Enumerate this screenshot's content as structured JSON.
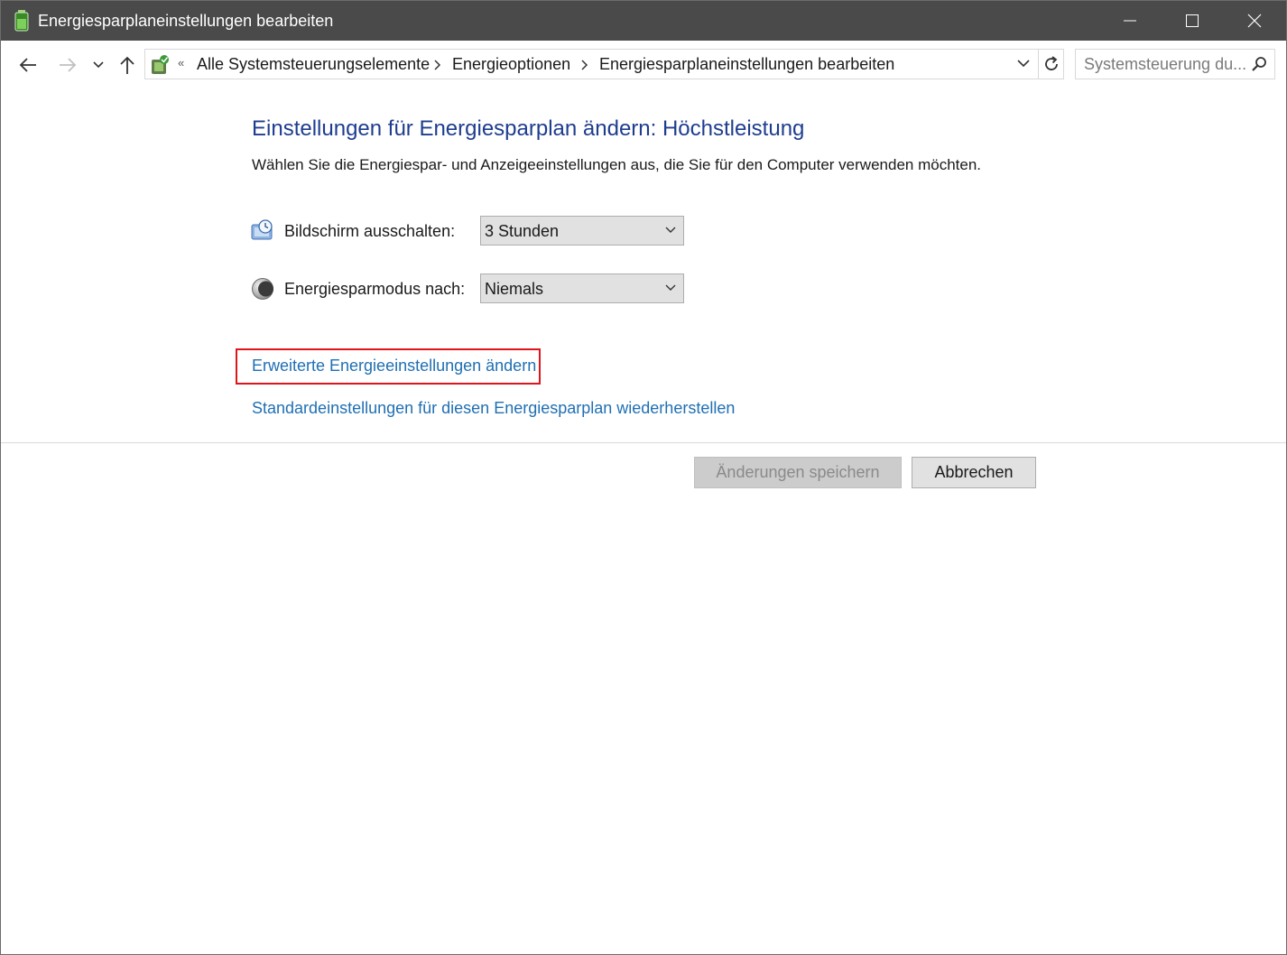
{
  "window": {
    "title": "Energiesparplaneinstellungen bearbeiten"
  },
  "navigation": {
    "overflow_glyph": "«",
    "breadcrumb": [
      {
        "label": "Alle Systemsteuerungselemente"
      },
      {
        "label": "Energieoptionen"
      },
      {
        "label": "Energiesparplaneinstellungen bearbeiten"
      }
    ],
    "search_placeholder": "Systemsteuerung du..."
  },
  "content": {
    "heading": "Einstellungen für Energiesparplan ändern: Höchstleistung",
    "description": "Wählen Sie die Energiespar- und Anzeigeeinstellungen aus, die Sie für den Computer verwenden möchten.",
    "settings": [
      {
        "label": "Bildschirm ausschalten:",
        "value": "3 Stunden",
        "icon": "display-icon"
      },
      {
        "label": "Energiesparmodus nach:",
        "value": "Niemals",
        "icon": "moon-icon"
      }
    ],
    "links": {
      "advanced": "Erweiterte Energieeinstellungen ändern",
      "restore": "Standardeinstellungen für diesen Energiesparplan wiederherstellen"
    },
    "highlight_color": "#e0141b",
    "heading_color": "#1e3d8f",
    "link_color": "#1f6fb3"
  },
  "buttons": {
    "save": "Änderungen speichern",
    "save_enabled": false,
    "cancel": "Abbrechen"
  },
  "titlebar_color": "#4a4a4a"
}
